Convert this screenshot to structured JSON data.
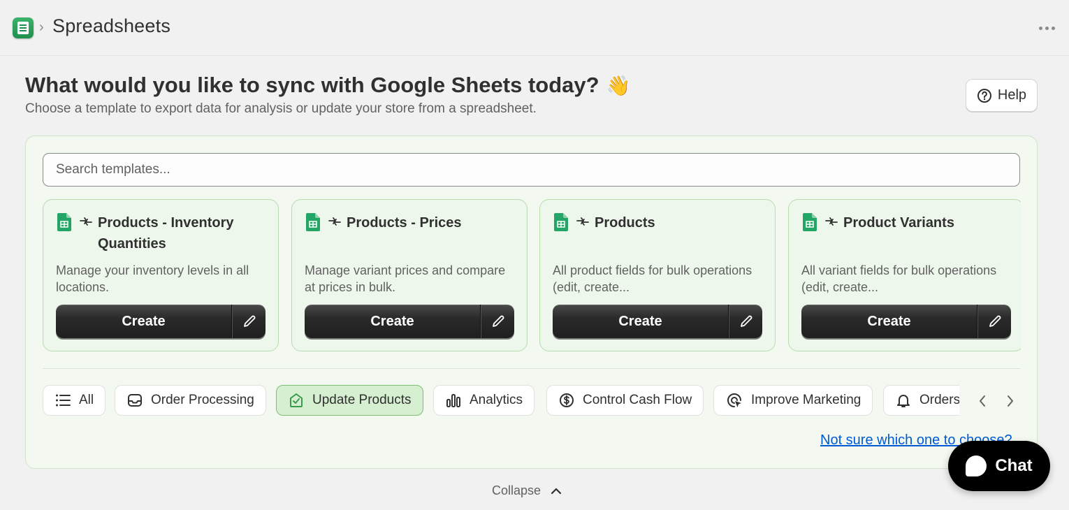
{
  "header": {
    "title": "Spreadsheets",
    "breadcrumb_separator": "›"
  },
  "intro": {
    "heading": "What would you like to sync with Google Sheets today?",
    "heading_emoji": "👋",
    "subheading": "Choose a template to export data for analysis or update your store from a spreadsheet.",
    "help_label": "Help"
  },
  "search": {
    "placeholder": "Search templates...",
    "value": ""
  },
  "templates": [
    {
      "title": "Products - Inventory Quantities",
      "description": "Manage your inventory levels in all locations.",
      "create_label": "Create"
    },
    {
      "title": "Products - Prices",
      "description": "Manage variant prices and compare at prices in bulk.",
      "create_label": "Create"
    },
    {
      "title": "Products",
      "description": "All product fields for bulk operations (edit, create...",
      "create_label": "Create"
    },
    {
      "title": "Product Variants",
      "description": "All variant fields for bulk operations (edit, create...",
      "create_label": "Create"
    }
  ],
  "categories": [
    {
      "label": "All",
      "icon": "list-icon"
    },
    {
      "label": "Order Processing",
      "icon": "inbox-icon"
    },
    {
      "label": "Update Products",
      "icon": "tag-check-icon",
      "active": true
    },
    {
      "label": "Analytics",
      "icon": "bar-chart-icon"
    },
    {
      "label": "Control Cash Flow",
      "icon": "dollar-circle-icon"
    },
    {
      "label": "Improve Marketing",
      "icon": "target-cursor-icon"
    },
    {
      "label": "Orders",
      "icon": "bell-icon"
    }
  ],
  "help_link": "Not sure which one to choose?",
  "collapse_label": "Collapse",
  "chat_label": "Chat",
  "colors": {
    "accent_green": "#1f8f4d",
    "active_chip_bg": "#d6efd0",
    "link_blue": "#005bd3",
    "button_dark": "#2a2a2a"
  }
}
